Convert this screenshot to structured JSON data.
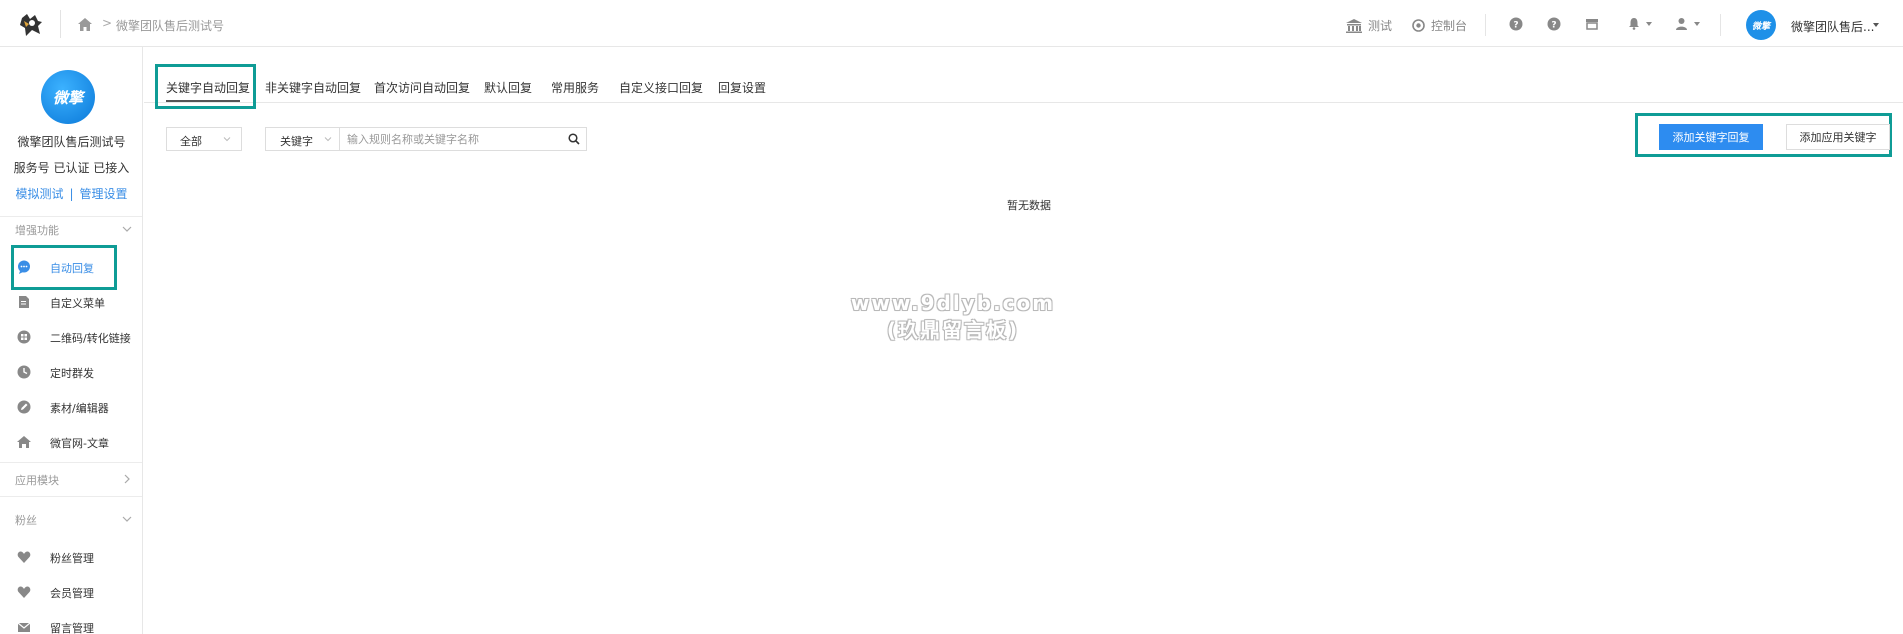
{
  "header": {
    "breadcrumb_text": "微擎团队售后测试号",
    "breadcrumb_separator": ">",
    "nav_test_label": "测试",
    "nav_console_label": "控制台",
    "account_name": "微擎团队售后...",
    "avatar_text": "微擎"
  },
  "sidebar": {
    "avatar_text": "微擎",
    "account_name": "微擎团队售后测试号",
    "account_status": "服务号 已认证 已接入",
    "link_simulate": "模拟测试",
    "link_divider": "|",
    "link_manage": "管理设置",
    "sections": [
      {
        "title": "增强功能",
        "expanded": true
      },
      {
        "title": "应用模块",
        "expanded": false
      },
      {
        "title": "粉丝",
        "expanded": true
      }
    ],
    "enhance_items": [
      {
        "label": "自动回复",
        "icon": "chat-bubble-icon",
        "active": true
      },
      {
        "label": "自定义菜单",
        "icon": "document-edit-icon"
      },
      {
        "label": "二维码/转化链接",
        "icon": "qrcode-icon"
      },
      {
        "label": "定时群发",
        "icon": "clock-send-icon"
      },
      {
        "label": "素材/编辑器",
        "icon": "pencil-icon"
      },
      {
        "label": "微官网-文章",
        "icon": "home-icon"
      }
    ],
    "fans_items": [
      {
        "label": "粉丝管理",
        "icon": "heart-icon"
      },
      {
        "label": "会员管理",
        "icon": "heart-icon"
      },
      {
        "label": "留言管理",
        "icon": "envelope-icon"
      }
    ]
  },
  "tabs": [
    {
      "label": "关键字自动回复",
      "active": true
    },
    {
      "label": "非关键字自动回复"
    },
    {
      "label": "首次访问自动回复"
    },
    {
      "label": "默认回复"
    },
    {
      "label": "常用服务"
    },
    {
      "label": "自定义接口回复"
    },
    {
      "label": "回复设置"
    }
  ],
  "filters": {
    "status_select": "全部",
    "search_type_select": "关键字",
    "search_placeholder": "输入规则名称或关键字名称",
    "search_value": ""
  },
  "actions": {
    "add_keyword_reply": "添加关键字回复",
    "add_app_keyword": "添加应用关键字"
  },
  "empty_text": "暂无数据",
  "watermark": {
    "line1": "www.9dlyb.com",
    "line2": "(玖鼎留言板)"
  },
  "colors": {
    "accent": "#2d8cf0",
    "link": "#3a8ee6",
    "highlight_box": "#0f9c96"
  }
}
